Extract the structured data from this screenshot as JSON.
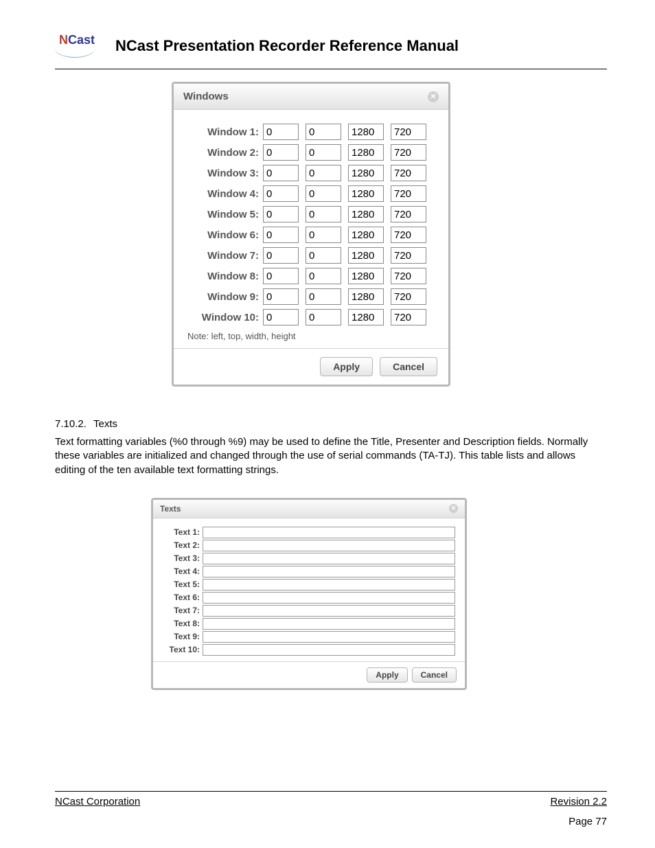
{
  "doc": {
    "title": "NCast Presentation Recorder Reference Manual",
    "logo_n": "N",
    "logo_cast": "Cast",
    "footer_left": "NCast Corporation",
    "footer_right": "Revision 2.2",
    "page_number": "Page 77"
  },
  "windows_dialog": {
    "title": "Windows",
    "note": "Note: left, top, width, height",
    "apply": "Apply",
    "cancel": "Cancel",
    "rows": [
      {
        "label": "Window 1:",
        "v": [
          "0",
          "0",
          "1280",
          "720"
        ]
      },
      {
        "label": "Window 2:",
        "v": [
          "0",
          "0",
          "1280",
          "720"
        ]
      },
      {
        "label": "Window 3:",
        "v": [
          "0",
          "0",
          "1280",
          "720"
        ]
      },
      {
        "label": "Window 4:",
        "v": [
          "0",
          "0",
          "1280",
          "720"
        ]
      },
      {
        "label": "Window 5:",
        "v": [
          "0",
          "0",
          "1280",
          "720"
        ]
      },
      {
        "label": "Window 6:",
        "v": [
          "0",
          "0",
          "1280",
          "720"
        ]
      },
      {
        "label": "Window 7:",
        "v": [
          "0",
          "0",
          "1280",
          "720"
        ]
      },
      {
        "label": "Window 8:",
        "v": [
          "0",
          "0",
          "1280",
          "720"
        ]
      },
      {
        "label": "Window 9:",
        "v": [
          "0",
          "0",
          "1280",
          "720"
        ]
      },
      {
        "label": "Window 10:",
        "v": [
          "0",
          "0",
          "1280",
          "720"
        ]
      }
    ]
  },
  "section": {
    "number": "7.10.2.",
    "title": "Texts",
    "paragraph": "Text formatting variables (%0 through %9) may be used to define the Title, Presenter and Description fields. Normally these variables are initialized and changed through the use of serial commands (TA-TJ). This table lists and allows editing of the ten available text formatting strings."
  },
  "texts_dialog": {
    "title": "Texts",
    "apply": "Apply",
    "cancel": "Cancel",
    "rows": [
      {
        "label": "Text 1:",
        "v": ""
      },
      {
        "label": "Text 2:",
        "v": ""
      },
      {
        "label": "Text 3:",
        "v": ""
      },
      {
        "label": "Text 4:",
        "v": ""
      },
      {
        "label": "Text 5:",
        "v": ""
      },
      {
        "label": "Text 6:",
        "v": ""
      },
      {
        "label": "Text 7:",
        "v": ""
      },
      {
        "label": "Text 8:",
        "v": ""
      },
      {
        "label": "Text 9:",
        "v": ""
      },
      {
        "label": "Text 10:",
        "v": ""
      }
    ]
  }
}
